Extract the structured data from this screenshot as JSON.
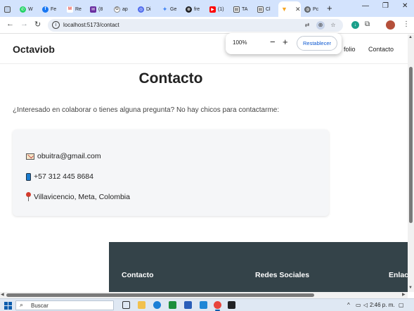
{
  "browser": {
    "tabs": [
      {
        "label": "W",
        "icon": "whatsapp-icon",
        "color": "#25d366"
      },
      {
        "label": "Fe",
        "icon": "facebook-icon",
        "color": "#1877f2"
      },
      {
        "label": "Re",
        "icon": "gmail-icon",
        "color": "#ea4335"
      },
      {
        "label": "(8",
        "icon": "mail-icon",
        "color": "#6a2ea0"
      },
      {
        "label": "ap",
        "icon": "google-icon",
        "color": "#9aa0a6"
      },
      {
        "label": "Di",
        "icon": "docs-icon",
        "color": "#4f6bed"
      },
      {
        "label": "Ge",
        "icon": "gemini-icon",
        "color": "#4285f4"
      },
      {
        "label": "fre",
        "icon": "openai-icon",
        "color": "#202124"
      },
      {
        "label": "(1)",
        "icon": "youtube-icon",
        "color": "#ff0000"
      },
      {
        "label": "TA",
        "icon": "page-icon",
        "color": "#3c4043"
      },
      {
        "label": "Cl",
        "icon": "page-icon",
        "color": "#3c4043"
      },
      {
        "label": "",
        "icon": "vite-icon",
        "color": "#f5a623",
        "active": true
      },
      {
        "label": "Pc",
        "icon": "globe-icon",
        "color": "#5f6368"
      }
    ],
    "new_tab": "+",
    "url": "localhost:5173/contact"
  },
  "zoom_popup": {
    "level": "100%",
    "minus": "−",
    "plus": "+",
    "reset_label": "Restablecer"
  },
  "site": {
    "brand": "Octaviob",
    "nav": {
      "portfolio_partial": "folio",
      "contact": "Contacto"
    },
    "title": "Contacto",
    "intro": "¿Interesado en colaborar o tienes alguna pregunta? No hay chicos para contactarme:",
    "contact": {
      "email": "obuitra@gmail.com",
      "phone": "+57 312 445 8684",
      "location": "Villavicencio, Meta, Colombia"
    },
    "footer": {
      "contact_heading": "Contacto",
      "social_heading": "Redes Sociales",
      "links_heading": "Enlac"
    }
  },
  "taskbar": {
    "search_placeholder": "Buscar",
    "time": "2:46 p. m."
  }
}
